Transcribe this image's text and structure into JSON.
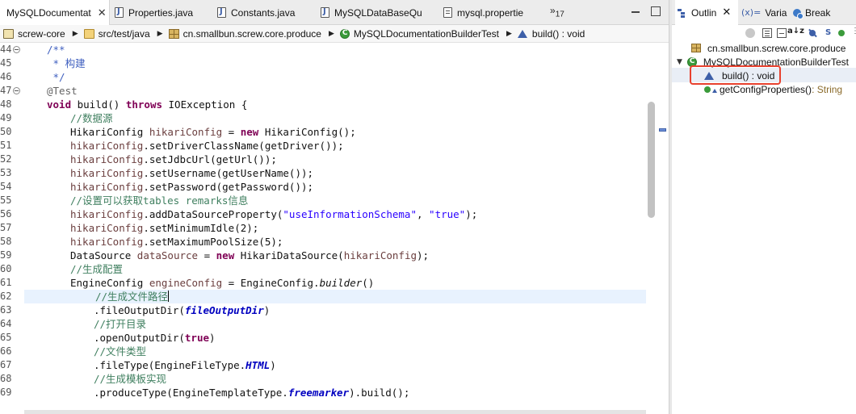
{
  "editor": {
    "tabs": [
      {
        "label": "MySQLDocumentat",
        "icon": "java-file-icon",
        "active": true
      },
      {
        "label": "Properties.java",
        "icon": "java-file-icon"
      },
      {
        "label": "Constants.java",
        "icon": "java-file-icon"
      },
      {
        "label": "MySQLDataBaseQu",
        "icon": "java-file-icon"
      },
      {
        "label": "mysql.propertie",
        "icon": "properties-file-icon"
      }
    ],
    "overflow_label": "»",
    "overflow_count": "17",
    "breadcrumb": [
      {
        "label": "screw-core",
        "icon": "project-icon"
      },
      {
        "label": "src/test/java",
        "icon": "source-folder-icon"
      },
      {
        "label": "cn.smallbun.screw.core.produce",
        "icon": "package-icon"
      },
      {
        "label": "MySQLDocumentationBuilderTest",
        "icon": "class-icon"
      },
      {
        "label": "build() : void",
        "icon": "method-icon"
      }
    ],
    "current_line": "62",
    "lines": [
      {
        "n": "44",
        "fold": true
      },
      {
        "n": "45"
      },
      {
        "n": "46"
      },
      {
        "n": "47",
        "fold": true
      },
      {
        "n": "48"
      },
      {
        "n": "49"
      },
      {
        "n": "50"
      },
      {
        "n": "51"
      },
      {
        "n": "52"
      },
      {
        "n": "53"
      },
      {
        "n": "54"
      },
      {
        "n": "55"
      },
      {
        "n": "56"
      },
      {
        "n": "57"
      },
      {
        "n": "58"
      },
      {
        "n": "59"
      },
      {
        "n": "60"
      },
      {
        "n": "61"
      },
      {
        "n": "62"
      },
      {
        "n": "63"
      },
      {
        "n": "64"
      },
      {
        "n": "65"
      },
      {
        "n": "66"
      },
      {
        "n": "67"
      },
      {
        "n": "68"
      },
      {
        "n": "69"
      }
    ],
    "code": {
      "t": {
        "jd_open": "/**",
        "jd_text": " * 构建",
        "jd_close": " */",
        "annotation": "@Test",
        "kw_void": "void",
        "kw_throws": "throws",
        "kw_new": "new",
        "kw_true": "true",
        "sig_name": " build() ",
        "sig_exc": " IOException {",
        "c_datasource": "//数据源",
        "t_hikari_type": "HikariConfig ",
        "v_hikari": "hikariConfig",
        "t_eq": " = ",
        "t_hikari_new": " HikariConfig();",
        "m_driver": ".setDriverClassName(getDriver());",
        "m_url": ".setJdbcUrl(getUrl());",
        "m_user": ".setUsername(getUserName());",
        "m_pass": ".setPassword(getPassword());",
        "c_remarks": "//设置可以获取tables remarks信息",
        "m_addprop": ".addDataSourceProperty(",
        "s_schema": "\"useInformationSchema\"",
        "t_comma": ", ",
        "s_true": "\"true\"",
        "t_close_paren": ");",
        "m_minidle": ".setMinimumIdle(2);",
        "m_maxpool": ".setMaximumPoolSize(5);",
        "t_ds_type": "DataSource ",
        "v_ds": "dataSource",
        "t_ds_new": " HikariDataSource(",
        "c_gen_config": "//生成配置",
        "t_engine_type": "EngineConfig ",
        "v_engine": "engineConfig",
        "t_engine_builder": " = EngineConfig.",
        "m_builder": "builder",
        "t_parens": "()",
        "c_gen_path": "//生成文件路径",
        "m_fileout": ".fileOutputDir(",
        "f_fileout": "fileOutputDir",
        "t_paren": ")",
        "c_open_dir": "//打开目录",
        "m_opendir": ".openOutputDir(",
        "c_file_type": "//文件类型",
        "m_filetype": ".fileType(EngineFileType.",
        "f_html": "HTML",
        "c_template": "//生成模板实现",
        "m_produce": ".produceType(EngineTemplateType.",
        "f_freemarker": "freemarker",
        "m_build_end": ").build();"
      }
    }
  },
  "outline": {
    "tabs": [
      {
        "label": "Outlin",
        "icon": "outline-icon",
        "active": true
      },
      {
        "label": "Varia",
        "icon": "variables-icon",
        "prefix": "(x)="
      },
      {
        "label": "Break",
        "icon": "breakpoints-icon"
      }
    ],
    "toolbar": {
      "sort_label": "a↓z",
      "focus_label": "S",
      "menu_label": "⋮"
    },
    "nodes": [
      {
        "label": "cn.smallbun.screw.core.produce",
        "icon": "package-icon"
      },
      {
        "label": "MySQLDocumentationBuilderTest",
        "icon": "class-icon",
        "expanded": true
      },
      {
        "label": "build() : void",
        "icon": "method-icon",
        "selected": true
      },
      {
        "label": "getConfigProperties()",
        "ret": " : String",
        "icon": "private-method-icon"
      }
    ]
  },
  "colors": {
    "selection_box": "#e8412e",
    "keyword": "#7f0055",
    "comment": "#3f7f5f",
    "string": "#2a00ff",
    "field": "#0000c0"
  }
}
